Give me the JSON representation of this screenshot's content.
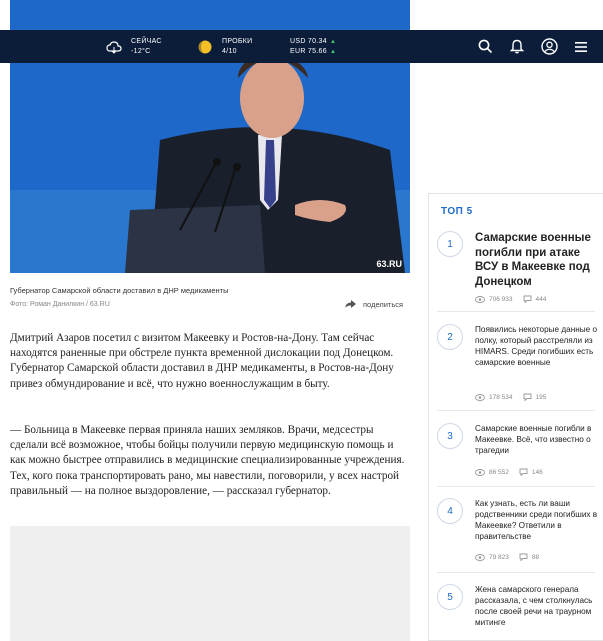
{
  "header": {
    "weather_label": "СЕЙЧАС",
    "weather_value": "-12°C",
    "traffic_label": "ПРОБКИ",
    "traffic_value": "4/10",
    "usd": "USD 70.34",
    "eur": "EUR 75.66",
    "up_arrow": "▲",
    "icons": [
      "cloud-icon",
      "traffic-sun-icon",
      "search-icon",
      "bell-icon",
      "user-icon",
      "menu-icon"
    ]
  },
  "photo": {
    "badge": "63.RU",
    "caption": "Губернатор Самарской области доставил в ДНР медикаменты",
    "credit": "Фото: Роман Данилкин / 63.RU"
  },
  "share_label": "поделиться",
  "article": {
    "p1": "Дмитрий Азаров посетил с визитом Макеевку и Ростов-на-Дону. Там сейчас находятся раненные при обстреле пункта временной дислокации под Донецком. Губернатор Самарской области доставил в ДНР медикаменты, в Ростов-на-Дону привез обмундирование и всё, что нужно военнослужащим в быту.",
    "p2": "— Больница в Макеевке первая приняла наших земляков. Врачи, медсестры сделали всё возможное, чтобы бойцы получили первую медицинскую помощь и как можно быстрее отправились в медицинские специализированные учреждения. Тех, кого пока транспортировать рано, мы навестили, поговорили, у всех настрой правильный — на полное выздоровление, — рассказал губернатор."
  },
  "top5": {
    "title": "ТОП 5",
    "items": [
      {
        "num": "1",
        "title": "Самарские военные погибли при атаке ВСУ в Макеевке под Донецком",
        "views": "706 933",
        "comments": "444"
      },
      {
        "num": "2",
        "title": "Появились некоторые данные о полку, который расстреляли из HIMARS. Среди погибших есть самарские военные",
        "views": "178 534",
        "comments": "195"
      },
      {
        "num": "3",
        "title": "Самарские военные погибли в Макеевке. Всё, что известно о трагедии",
        "views": "86 552",
        "comments": "146"
      },
      {
        "num": "4",
        "title": "Как узнать, есть ли ваши родственники среди погибших в Макеевке? Ответили в правительстве",
        "views": "79 823",
        "comments": "88"
      },
      {
        "num": "5",
        "title": "Жена самарского генерала рассказала, с чем столкнулась после своей речи на траурном митинге",
        "views": "",
        "comments": ""
      }
    ]
  },
  "colors": {
    "topbar": "#0c1d3a",
    "accent": "#1e6cc7",
    "up": "#3ec76b"
  }
}
